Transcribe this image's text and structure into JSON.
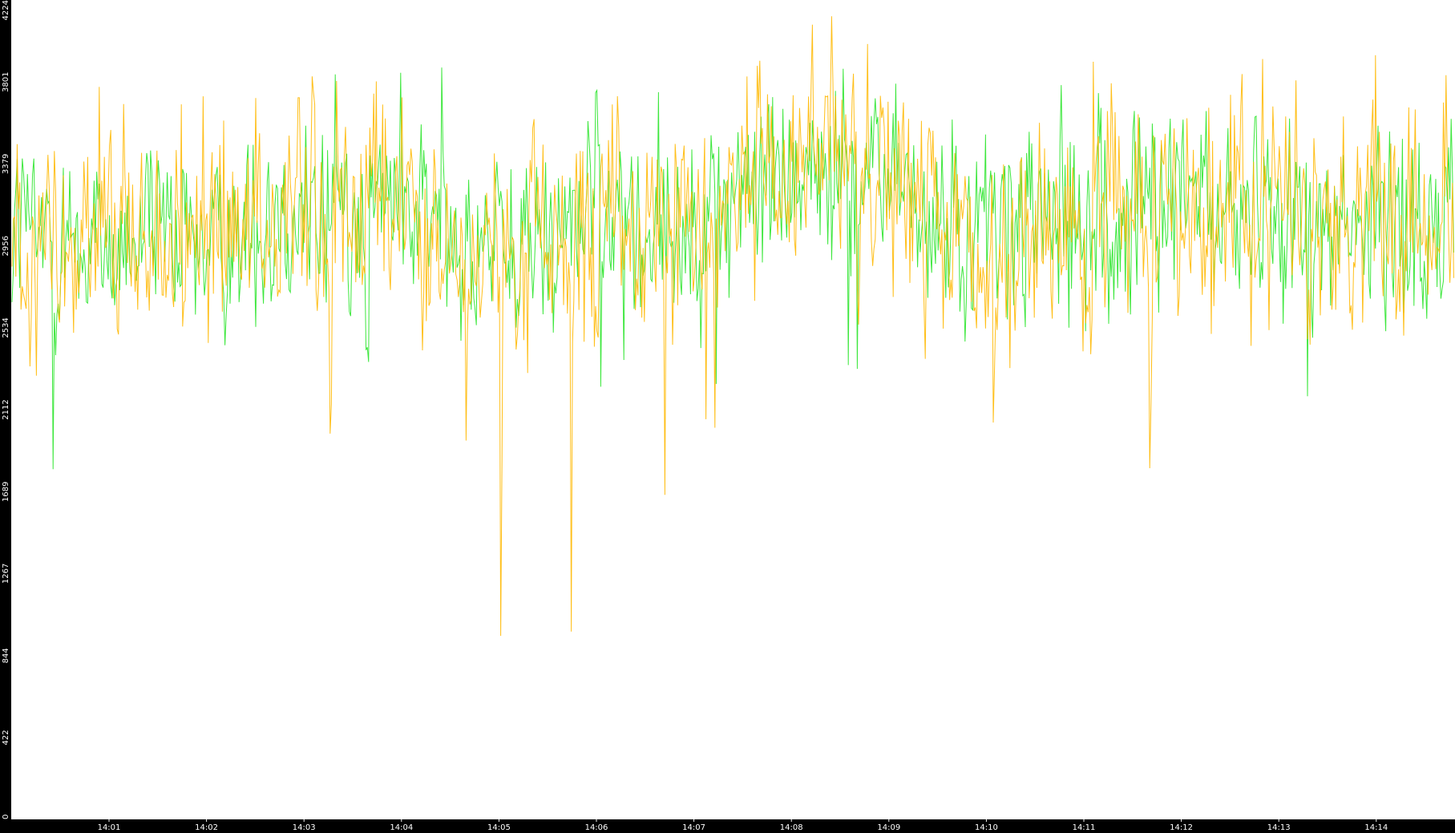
{
  "chart_data": {
    "type": "line",
    "title": "",
    "xlabel": "",
    "ylabel": "",
    "y_ticks": [
      "0",
      "422",
      "844",
      "1267",
      "1689",
      "2112",
      "2534",
      "2956",
      "3379",
      "3801",
      "4224"
    ],
    "ylim": [
      0,
      4224
    ],
    "x_ticks": [
      "14:01",
      "14:02",
      "14:03",
      "14:04",
      "14:05",
      "14:06",
      "14:07",
      "14:08",
      "14:09",
      "14:10",
      "14:11",
      "14:12",
      "14:13",
      "14:14"
    ],
    "x_range": [
      "14:00:01",
      "14:14:53"
    ],
    "grid": false,
    "legend": "none",
    "colors": {
      "background": "#000000",
      "plot": "#ffffff",
      "series_a": "#33e633",
      "series_b": "#ffb800",
      "text": "#ffffff"
    },
    "series": [
      {
        "color": "#33e633",
        "approx_range": [
          1550,
          4050
        ],
        "typical_band": [
          2400,
          3600
        ],
        "x_segments": [
          "14:00",
          "14:01",
          "14:02",
          "14:03",
          "14:04",
          "14:05",
          "14:06",
          "14:07",
          "14:08",
          "14:09",
          "14:10",
          "14:11",
          "14:12",
          "14:13",
          "14:14"
        ],
        "segment_means": [
          3100,
          2950,
          3000,
          3150,
          3200,
          2900,
          3150,
          3050,
          3350,
          3300,
          3000,
          3100,
          3150,
          3150,
          3100
        ],
        "segment_mins": [
          1790,
          2020,
          2230,
          2340,
          2370,
          1620,
          2230,
          2160,
          2320,
          2430,
          1850,
          2040,
          2150,
          2100,
          1520
        ],
        "segment_maxs": [
          4050,
          3810,
          3650,
          3910,
          3930,
          3600,
          3760,
          3780,
          3900,
          3940,
          3820,
          3800,
          3710,
          3760,
          3950
        ]
      },
      {
        "color": "#ffb800",
        "approx_range": [
          900,
          4224
        ],
        "typical_band": [
          2300,
          3700
        ],
        "x_segments": [
          "14:00",
          "14:01",
          "14:02",
          "14:03",
          "14:04",
          "14:05",
          "14:06",
          "14:07",
          "14:08",
          "14:09",
          "14:10",
          "14:11",
          "14:12",
          "14:13",
          "14:14"
        ],
        "segment_means": [
          3050,
          2900,
          2950,
          3100,
          3150,
          2850,
          3100,
          3050,
          3400,
          3300,
          3000,
          3100,
          3100,
          3100,
          3050
        ],
        "segment_mins": [
          1380,
          1880,
          2070,
          1980,
          1870,
          930,
          1580,
          1930,
          2280,
          2350,
          1940,
          1800,
          1850,
          1680,
          1800
        ],
        "segment_maxs": [
          3850,
          3750,
          3720,
          3830,
          4224,
          3700,
          3920,
          3960,
          4140,
          4190,
          3860,
          3920,
          3890,
          3920,
          3950
        ]
      }
    ]
  }
}
